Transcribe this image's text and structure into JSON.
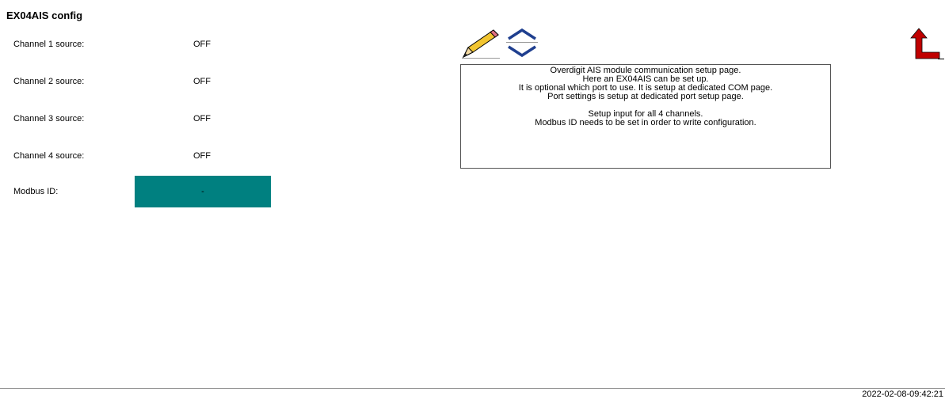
{
  "header": {
    "title": "EX04AIS config"
  },
  "channels": [
    {
      "label": "Channel 1 source:",
      "value": "OFF"
    },
    {
      "label": "Channel 2 source:",
      "value": "OFF"
    },
    {
      "label": "Channel 3 source:",
      "value": "OFF"
    },
    {
      "label": "Channel 4 source:",
      "value": "OFF"
    }
  ],
  "modbus": {
    "label": "Modbus ID:",
    "value": "-",
    "color": "#008080"
  },
  "info": {
    "lines": [
      "Overdigit AIS module communication setup page.",
      "Here an EX04AIS can be set up.",
      "It is optional which port to use. It is setup at dedicated COM page.",
      "Port settings is setup at dedicated port setup page.",
      "",
      "Setup input for all 4 channels.",
      "Modbus ID needs to be set in order to write configuration."
    ]
  },
  "icons": {
    "edit": "pencil-icon",
    "scroll_up": "chevron-up-icon",
    "scroll_down": "chevron-down-icon",
    "back": "return-arrow-icon",
    "accent_blue": "#1f3f8f",
    "back_red": "#c00000"
  },
  "footer": {
    "timestamp": "2022-02-08-09:42:21"
  }
}
